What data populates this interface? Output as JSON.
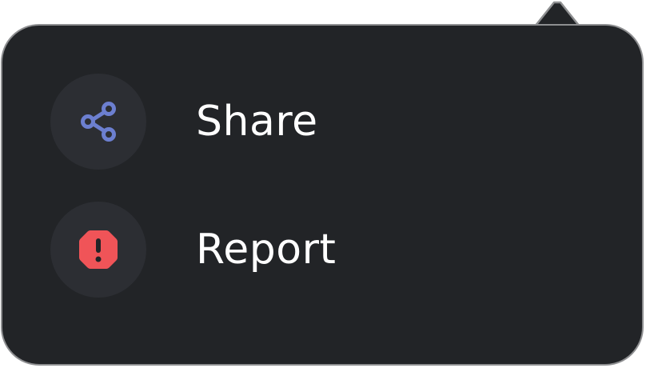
{
  "menu": {
    "items": [
      {
        "label": "Share",
        "icon": "share-icon",
        "icon_color": "#6c7fd0"
      },
      {
        "label": "Report",
        "icon": "alert-octagon-icon",
        "icon_color": "#f05458"
      }
    ]
  },
  "colors": {
    "background": "#222427",
    "border": "#8e8f91",
    "icon_circle": "#2c2e33",
    "text": "#ffffff"
  }
}
